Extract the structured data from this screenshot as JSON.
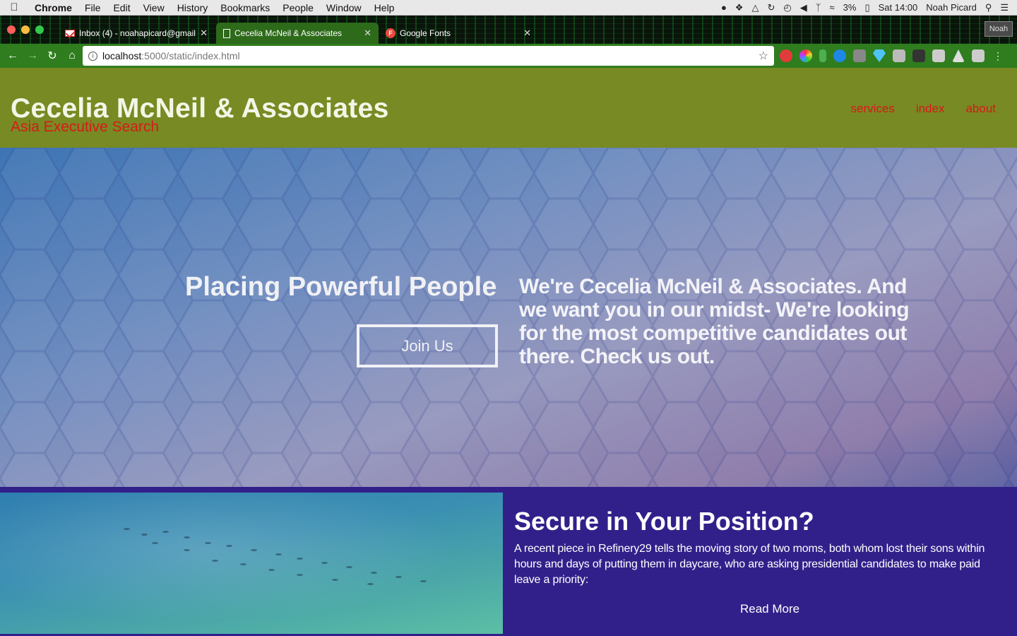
{
  "menubar": {
    "app_name": "Chrome",
    "items": [
      "File",
      "Edit",
      "View",
      "History",
      "Bookmarks",
      "People",
      "Window",
      "Help"
    ],
    "battery": "3%",
    "clock": "Sat 14:00",
    "user": "Noah Picard"
  },
  "tabs": [
    {
      "title": "Inbox (4) - noahapicard@gmail",
      "icon": "gmail-icon"
    },
    {
      "title": "Cecelia McNeil & Associates",
      "icon": "document-icon"
    },
    {
      "title": "Google Fonts",
      "icon": "google-fonts-icon"
    }
  ],
  "profile_badge": "Noah",
  "address_bar": {
    "host": "localhost",
    "path": ":5000/static/index.html"
  },
  "site": {
    "brand_title": "Cecelia McNeil & Associates",
    "brand_subtitle": "Asia Executive Search",
    "nav": [
      "services",
      "index",
      "about"
    ],
    "hero": {
      "headline": "Placing Powerful People",
      "cta": "Join Us",
      "text": "We're Cecelia McNeil & Associates. And we want you in our midst- We're looking for the most competitive candidates out there. Check us out."
    },
    "feature": {
      "title": "Secure in Your Position?",
      "body": "A recent piece in Refinery29 tells the moving story of two moms, both whom lost their sons within hours and days of putting them in daycare, who are asking presidential candidates to make paid leave a priority:",
      "link": "Read More"
    }
  },
  "colors": {
    "header_bg": "#788a23",
    "accent_red": "#d61a1a",
    "feature_bg": "#32208a",
    "toolbar_green": "#2f7d1e"
  }
}
